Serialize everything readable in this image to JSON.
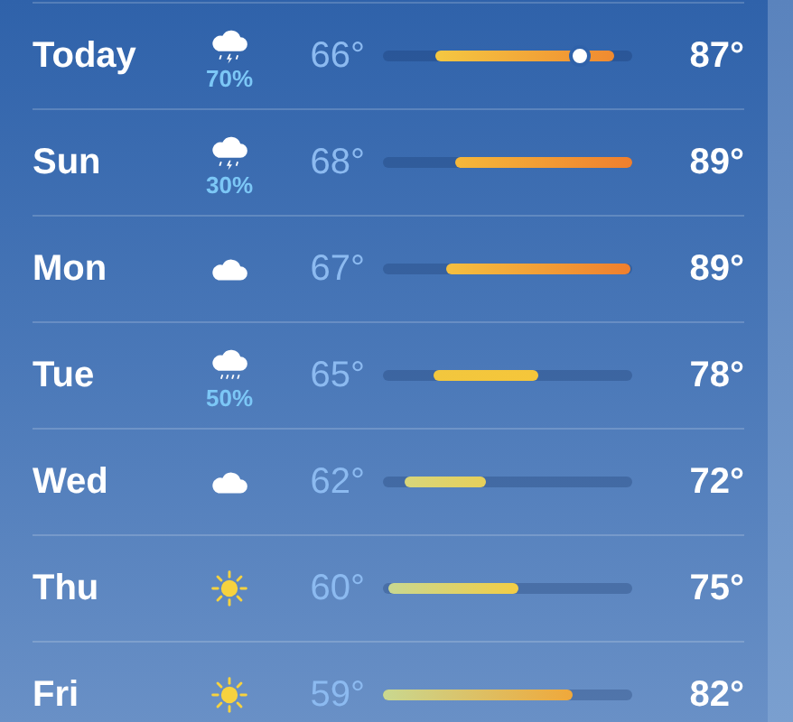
{
  "days": [
    {
      "day": "Today",
      "kind": "thunderstorm",
      "precip": "70%",
      "low": "66°",
      "high": "87°",
      "current_marker": {
        "level": 0.79
      }
    },
    {
      "day": "Sun",
      "kind": "thunderstorm",
      "precip": "30%",
      "low": "68°",
      "high": "89°"
    },
    {
      "day": "Mon",
      "kind": "cloud",
      "low": "67°",
      "high": "89°"
    },
    {
      "day": "Tue",
      "kind": "rain",
      "precip": "50%",
      "low": "65°",
      "high": "78°"
    },
    {
      "day": "Wed",
      "kind": "cloud",
      "low": "62°",
      "high": "72°"
    },
    {
      "day": "Thu",
      "kind": "sun",
      "low": "60°",
      "high": "75°"
    },
    {
      "day": "Fri",
      "kind": "sun",
      "low": "59°",
      "high": "82°"
    }
  ]
}
